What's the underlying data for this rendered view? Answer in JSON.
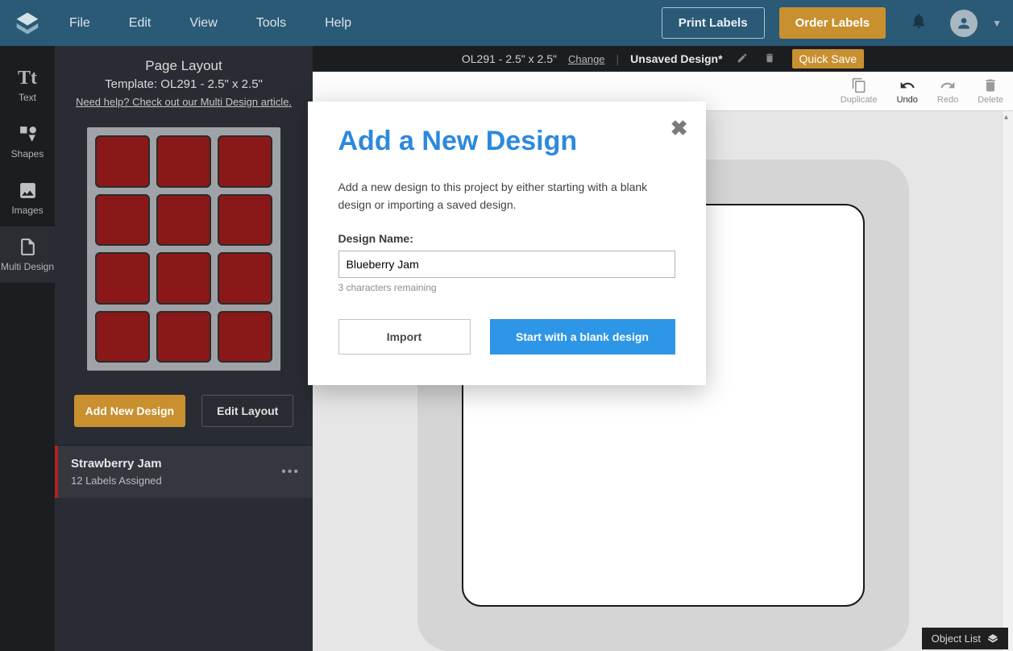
{
  "topbar": {
    "menus": [
      "File",
      "Edit",
      "View",
      "Tools",
      "Help"
    ],
    "print_label": "Print Labels",
    "order_label": "Order Labels"
  },
  "iconrail": {
    "items": [
      {
        "label": "Text"
      },
      {
        "label": "Shapes"
      },
      {
        "label": "Images"
      },
      {
        "label": "Multi Design"
      }
    ]
  },
  "sidepanel": {
    "title": "Page Layout",
    "subtitle": "Template: OL291 - 2.5\" x 2.5\"",
    "help": "Need help? Check out our Multi Design article.",
    "add_btn": "Add New Design",
    "edit_btn": "Edit Layout",
    "designs": [
      {
        "name": "Strawberry Jam",
        "sub": "12 Labels Assigned"
      }
    ]
  },
  "infobar": {
    "template": "OL291 - 2.5\" x 2.5\"",
    "change": "Change",
    "unsaved": "Unsaved Design*",
    "qsave": "Quick Save"
  },
  "toolbar": {
    "duplicate": "Duplicate",
    "undo": "Undo",
    "redo": "Redo",
    "delete": "Delete"
  },
  "objectlist": "Object List",
  "modal": {
    "title": "Add a New Design",
    "desc": "Add a new design to this project by either starting with a blank design or importing a saved design.",
    "label": "Design Name:",
    "value": "Blueberry Jam",
    "hint": "3 characters remaining",
    "import": "Import",
    "start": "Start with a blank design"
  }
}
